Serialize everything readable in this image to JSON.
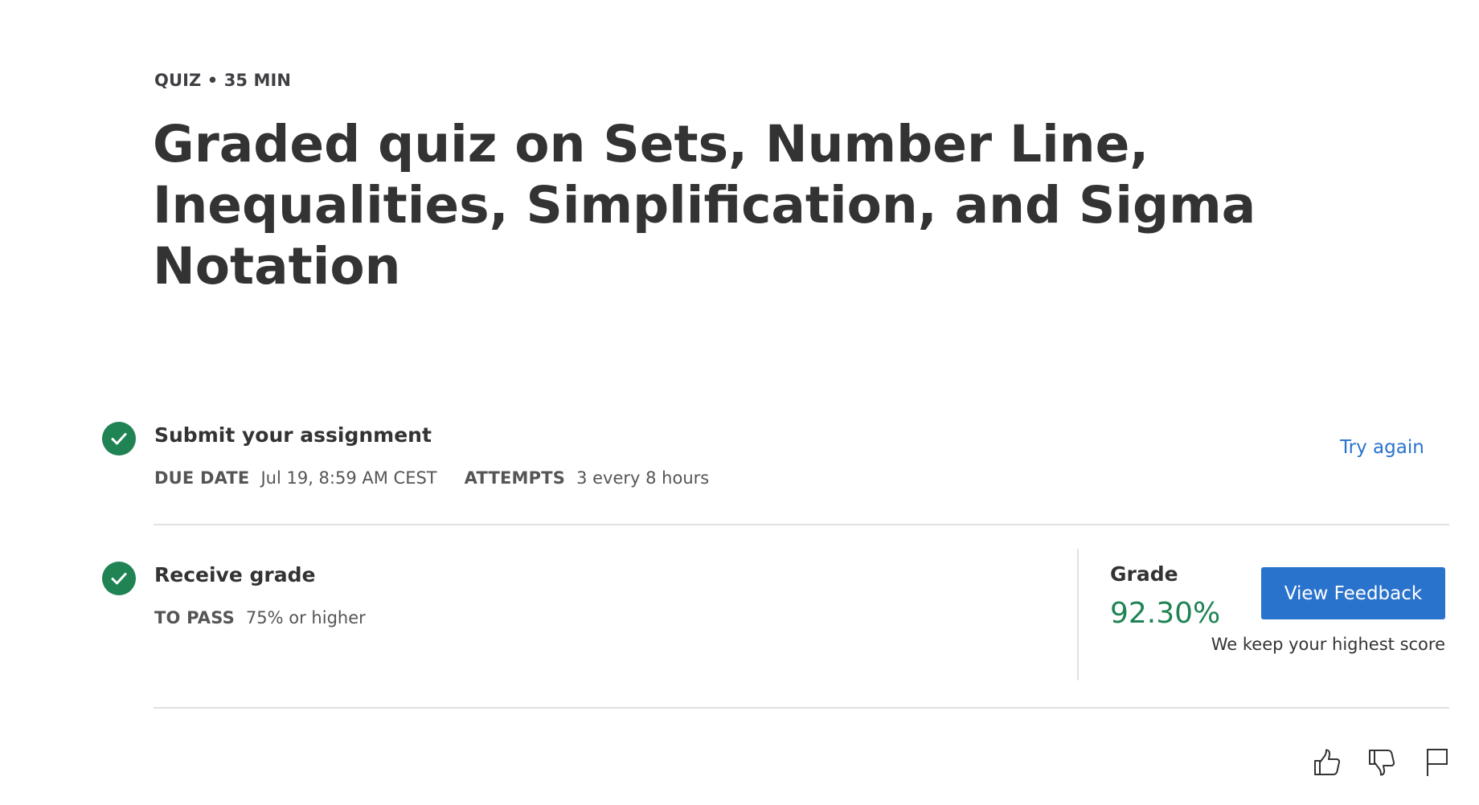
{
  "header": {
    "meta": "QUIZ • 35 MIN",
    "title": "Graded quiz on Sets, Number Line, Inequalities, Simplification, and Sigma Notation"
  },
  "submit": {
    "title": "Submit your assignment",
    "due_date_label": "DUE DATE",
    "due_date_value": "Jul 19, 8:59 AM CEST",
    "attempts_label": "ATTEMPTS",
    "attempts_value": "3 every 8 hours",
    "try_again_label": "Try again"
  },
  "receive": {
    "title": "Receive grade",
    "to_pass_label": "TO PASS",
    "to_pass_value": "75% or higher"
  },
  "grade": {
    "label": "Grade",
    "value": "92.30%",
    "button_label": "View Feedback",
    "note": "We keep your highest score"
  },
  "icons": {
    "step_check": "check-circle-icon",
    "like": "thumbs-up-icon",
    "dislike": "thumbs-down-icon",
    "report": "flag-icon"
  },
  "colors": {
    "accent_blue": "#2a73cc",
    "success_green": "#1f8354",
    "divider": "#e1e1e1"
  }
}
